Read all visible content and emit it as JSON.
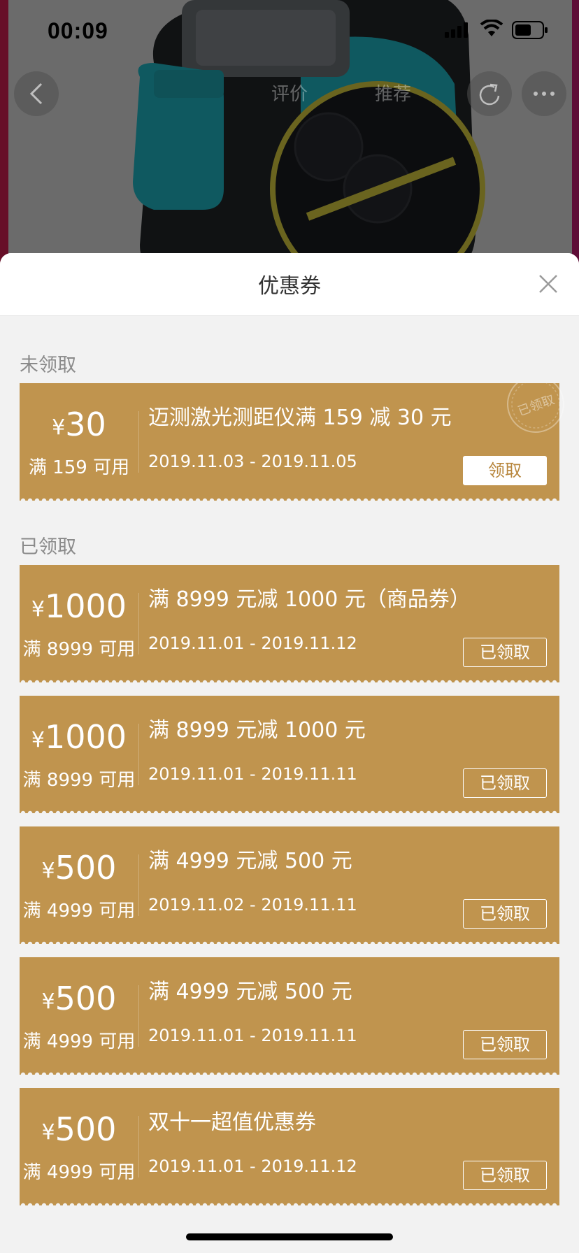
{
  "status_bar": {
    "time": "00:09"
  },
  "navbar": {
    "tab_1": "评价",
    "tab_2": "推荐"
  },
  "sheet": {
    "title": "优惠券"
  },
  "sections": {
    "unclaimed": "未领取",
    "claimed": "已领取"
  },
  "stamp_text": "已领取",
  "coupons": [
    {
      "currency": "¥",
      "amount": "30",
      "condition": "满 159 可用",
      "title": "迈测激光测距仪满 159 减 30 元",
      "dates": "2019.11.03 - 2019.11.05",
      "button": "领取",
      "state": "unclaimed"
    },
    {
      "currency": "¥",
      "amount": "1000",
      "condition": "满 8999 可用",
      "title": "满 8999 元减 1000 元（商品券）",
      "dates": "2019.11.01 - 2019.11.12",
      "button": "已领取",
      "state": "claimed"
    },
    {
      "currency": "¥",
      "amount": "1000",
      "condition": "满 8999 可用",
      "title": "满 8999 元减 1000 元",
      "dates": "2019.11.01 - 2019.11.11",
      "button": "已领取",
      "state": "claimed"
    },
    {
      "currency": "¥",
      "amount": "500",
      "condition": "满 4999 可用",
      "title": "满 4999 元减 500 元",
      "dates": "2019.11.02 - 2019.11.11",
      "button": "已领取",
      "state": "claimed"
    },
    {
      "currency": "¥",
      "amount": "500",
      "condition": "满 4999 可用",
      "title": "满 4999 元减 500 元",
      "dates": "2019.11.01 - 2019.11.11",
      "button": "已领取",
      "state": "claimed"
    },
    {
      "currency": "¥",
      "amount": "500",
      "condition": "满 4999 可用",
      "title": "双十一超值优惠券",
      "dates": "2019.11.01 - 2019.11.12",
      "button": "已领取",
      "state": "claimed"
    }
  ],
  "colors": {
    "coupon_bg": "#c0944e",
    "sheet_bg": "#f2f2f2",
    "label_gray": "#8a8a8a"
  }
}
